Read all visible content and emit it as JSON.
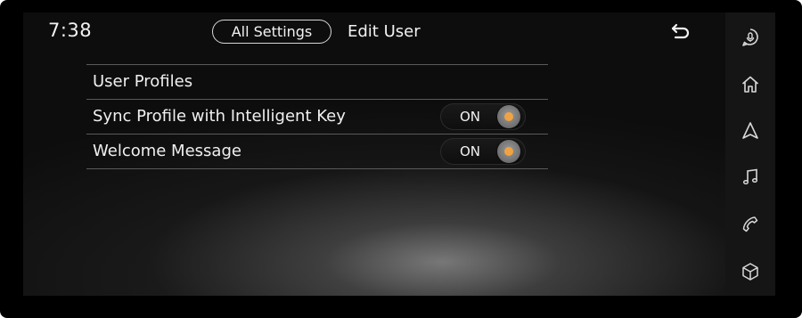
{
  "status": {
    "time": "7:38"
  },
  "header": {
    "back_button_label": "All Settings",
    "title": "Edit User",
    "return_icon": "return-arrow-icon"
  },
  "settings": {
    "rows": [
      {
        "label": "User Profiles"
      },
      {
        "label": "Sync Profile with Intelligent Key",
        "toggle": {
          "state": "ON",
          "on": true
        }
      },
      {
        "label": "Welcome Message",
        "toggle": {
          "state": "ON",
          "on": true
        }
      }
    ]
  },
  "sidebar": {
    "icons": [
      "voice-assistant-icon",
      "home-icon",
      "navigation-icon",
      "music-icon",
      "phone-icon",
      "apps-cube-icon"
    ]
  },
  "colors": {
    "accent": "#f2a341",
    "background": "#0d0d0d",
    "text": "#f2f2f2",
    "divider": "#5a5a5a"
  }
}
